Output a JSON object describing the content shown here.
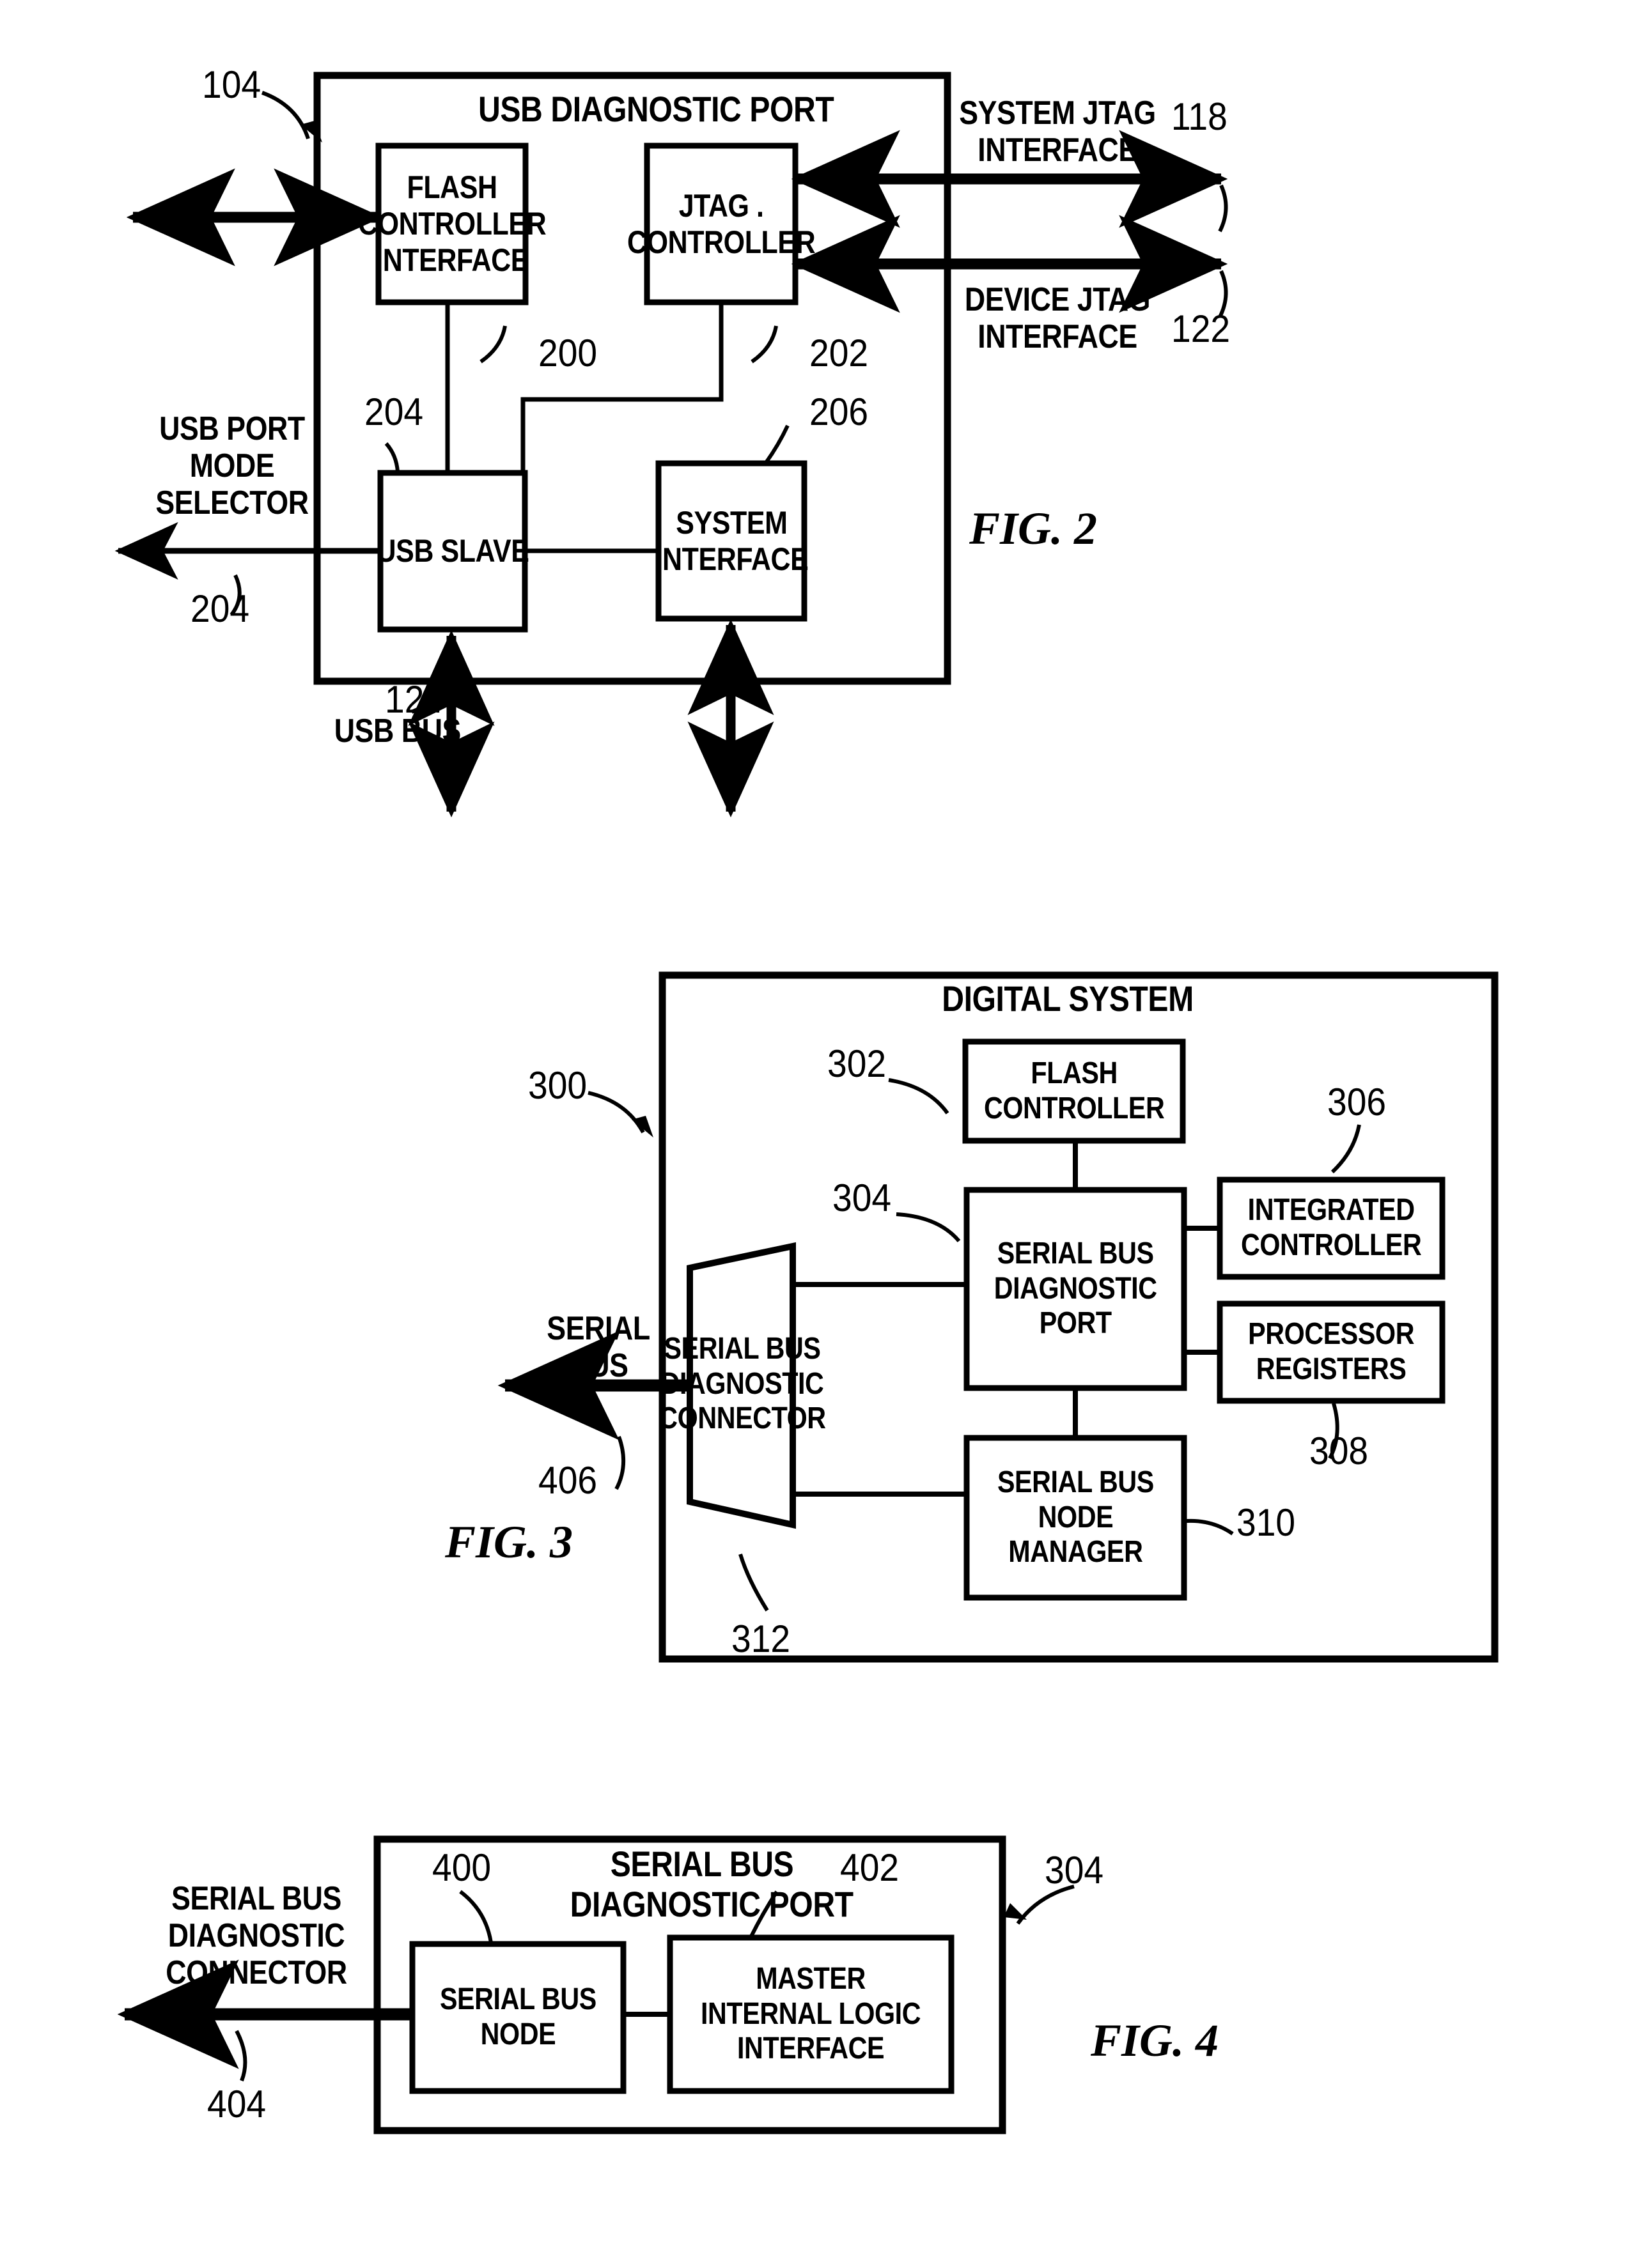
{
  "document": {
    "type": "patent-drawing-sheet",
    "figures": [
      "FIG. 2",
      "FIG. 3",
      "FIG. 4"
    ]
  },
  "fig2": {
    "caption": "FIG. 2",
    "container_title": "USB DIAGNOSTIC PORT",
    "container_ref": "104",
    "boxes": {
      "flash_controller_interface": "FLASH\nCONTROLLER\nINTERFACE",
      "jtag_controller": "JTAG .\nCONTROLLER",
      "usb_slave": "USB SLAVE",
      "system_interface": "SYSTEM\nINTERFACE"
    },
    "refs": {
      "flash_controller_interface": "200",
      "jtag_controller": "202",
      "usb_slave": "204",
      "system_interface": "206",
      "usb_bus": "124",
      "mode_selector": "204",
      "system_jtag": "118",
      "device_jtag": "122"
    },
    "labels": {
      "system_jtag_interface": "SYSTEM JTAG\nINTERFACE",
      "device_jtag_interface": "DEVICE JTAG\nINTERFACE",
      "usb_port_mode_selector": "USB PORT\nMODE\nSELECTOR",
      "usb_bus": "USB BUS"
    }
  },
  "fig3": {
    "caption": "FIG. 3",
    "container_title": "DIGITAL SYSTEM",
    "container_ref": "300",
    "boxes": {
      "flash_controller": "FLASH\nCONTROLLER",
      "serial_bus_diagnostic_port": "SERIAL BUS\nDIAGNOSTIC\nPORT",
      "integrated_controller": "INTEGRATED\nCONTROLLER",
      "processor_registers": "PROCESSOR\nREGISTERS",
      "serial_bus_node_manager": "SERIAL BUS\nNODE\nMANAGER",
      "serial_bus_diagnostic_connector": "SERIAL BUS\nDIAGNOSTIC\nCONNECTOR"
    },
    "refs": {
      "flash_controller": "302",
      "serial_bus_diagnostic_port": "304",
      "integrated_controller": "306",
      "processor_registers": "308",
      "serial_bus_node_manager": "310",
      "serial_bus_diagnostic_connector": "312",
      "serial_bus": "406"
    },
    "labels": {
      "serial_bus": "SERIAL\nBUS"
    }
  },
  "fig4": {
    "caption": "FIG. 4",
    "container_title": "SERIAL BUS\nDIAGNOSTIC PORT",
    "container_ref": "304",
    "boxes": {
      "serial_bus_node": "SERIAL BUS\nNODE",
      "master_internal_logic_interface": "MASTER\nINTERNAL LOGIC\nINTERFACE"
    },
    "refs": {
      "serial_bus_node": "400",
      "master_internal_logic_interface": "402",
      "serial_bus_diagnostic_connector": "404"
    },
    "labels": {
      "serial_bus_diagnostic_connector": "SERIAL BUS\nDIAGNOSTIC\nCONNECTOR"
    }
  },
  "colors": {
    "ink": "#000000",
    "paper": "#ffffff"
  }
}
